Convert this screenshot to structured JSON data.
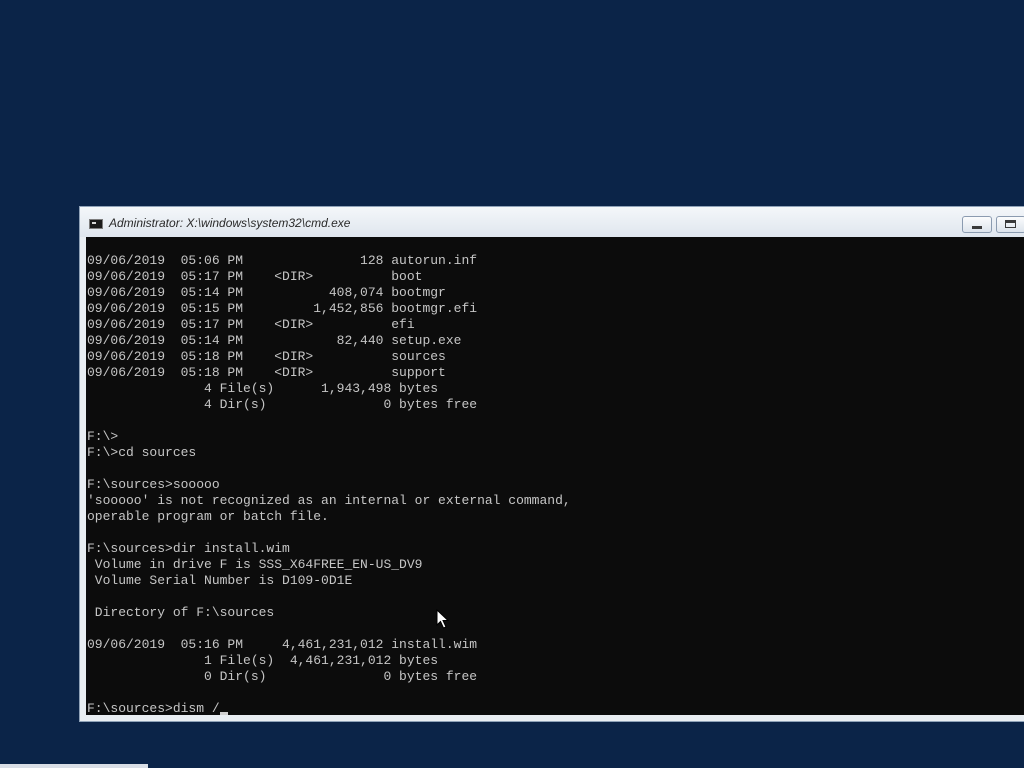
{
  "window": {
    "title": "Administrator: X:\\windows\\system32\\cmd.exe",
    "icon": "cmd-app-icon",
    "buttons": [
      "minimize",
      "maximize"
    ]
  },
  "console": {
    "lines": [
      "09/06/2019  05:06 PM               128 autorun.inf",
      "09/06/2019  05:17 PM    <DIR>          boot",
      "09/06/2019  05:14 PM           408,074 bootmgr",
      "09/06/2019  05:15 PM         1,452,856 bootmgr.efi",
      "09/06/2019  05:17 PM    <DIR>          efi",
      "09/06/2019  05:14 PM            82,440 setup.exe",
      "09/06/2019  05:18 PM    <DIR>          sources",
      "09/06/2019  05:18 PM    <DIR>          support",
      "               4 File(s)      1,943,498 bytes",
      "               4 Dir(s)               0 bytes free",
      "",
      "F:\\>",
      "F:\\>cd sources",
      "",
      "F:\\sources>sooooo",
      "'sooooo' is not recognized as an internal or external command,",
      "operable program or batch file.",
      "",
      "F:\\sources>dir install.wim",
      " Volume in drive F is SSS_X64FREE_EN-US_DV9",
      " Volume Serial Number is D109-0D1E",
      "",
      " Directory of F:\\sources",
      "",
      "09/06/2019  05:16 PM     4,461,231,012 install.wim",
      "               1 File(s)  4,461,231,012 bytes",
      "               0 Dir(s)               0 bytes free",
      ""
    ],
    "prompt": "F:\\sources>",
    "current_input": "dism /"
  },
  "colors": {
    "desktop": "#0b2448",
    "console_background": "#0c0c0c",
    "console_text": "#c6c6c6",
    "titlebar": "#e9eef3"
  }
}
